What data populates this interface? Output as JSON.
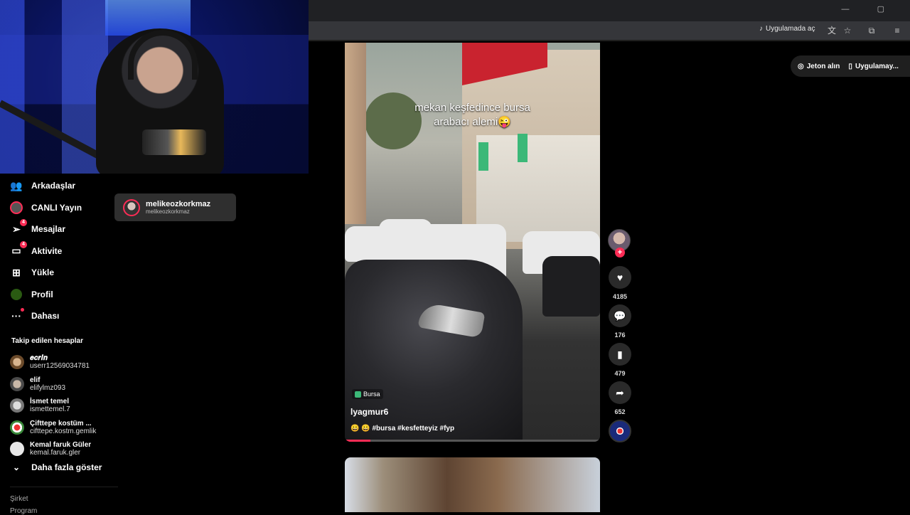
{
  "browser": {
    "open_in_app_label": "Uygulamada aç",
    "window_controls": "— ▢"
  },
  "top_actions": {
    "coins_label": "Jeton alın",
    "app_label": "Uygulamay..."
  },
  "sidebar": {
    "nav": [
      {
        "label": "Arkadaşlar",
        "icon": "friends-icon"
      },
      {
        "label": "CANLI Yayın",
        "icon": "live-icon"
      },
      {
        "label": "Mesajlar",
        "icon": "messages-icon",
        "badge": "4"
      },
      {
        "label": "Aktivite",
        "icon": "activity-icon",
        "badge": "4"
      },
      {
        "label": "Yükle",
        "icon": "upload-icon"
      },
      {
        "label": "Profil",
        "icon": "profile-avatar-icon"
      },
      {
        "label": "Dahası",
        "icon": "more-icon"
      }
    ],
    "live_popup": {
      "name": "melikeozkorkmaz",
      "handle": "melikeozkorkmaz"
    },
    "following_title": "Takip edilen hesaplar",
    "following": [
      {
        "name": "𝒆𝒄𝒓𝒊𝒏",
        "handle": "userr12569034781"
      },
      {
        "name": "elif",
        "handle": "elifylmz093"
      },
      {
        "name": "İsmet temel",
        "handle": "ismettemel.7"
      },
      {
        "name": "Çifttepe kostüm ...",
        "handle": "cifttepe.kostm.gemlik"
      },
      {
        "name": "Kemal faruk Güler",
        "handle": "kemal.faruk.gler"
      }
    ],
    "show_more_label": "Daha fazla göster",
    "footer": [
      "Şirket",
      "Program"
    ]
  },
  "video": {
    "overlay_caption": "mekan keşfedince bursa\narabacı alemi😜",
    "location_tag": "Bursa",
    "author": "lyagmur6",
    "description": "😀 😀 #bursa #kesfetteyiz #fyp",
    "progress": 0.1
  },
  "actions": {
    "likes": "4185",
    "comments": "176",
    "saves": "479",
    "shares": "652"
  },
  "colors": {
    "accent": "#fe2c55",
    "background": "#000000",
    "popup_bg": "#2f2f2f"
  }
}
